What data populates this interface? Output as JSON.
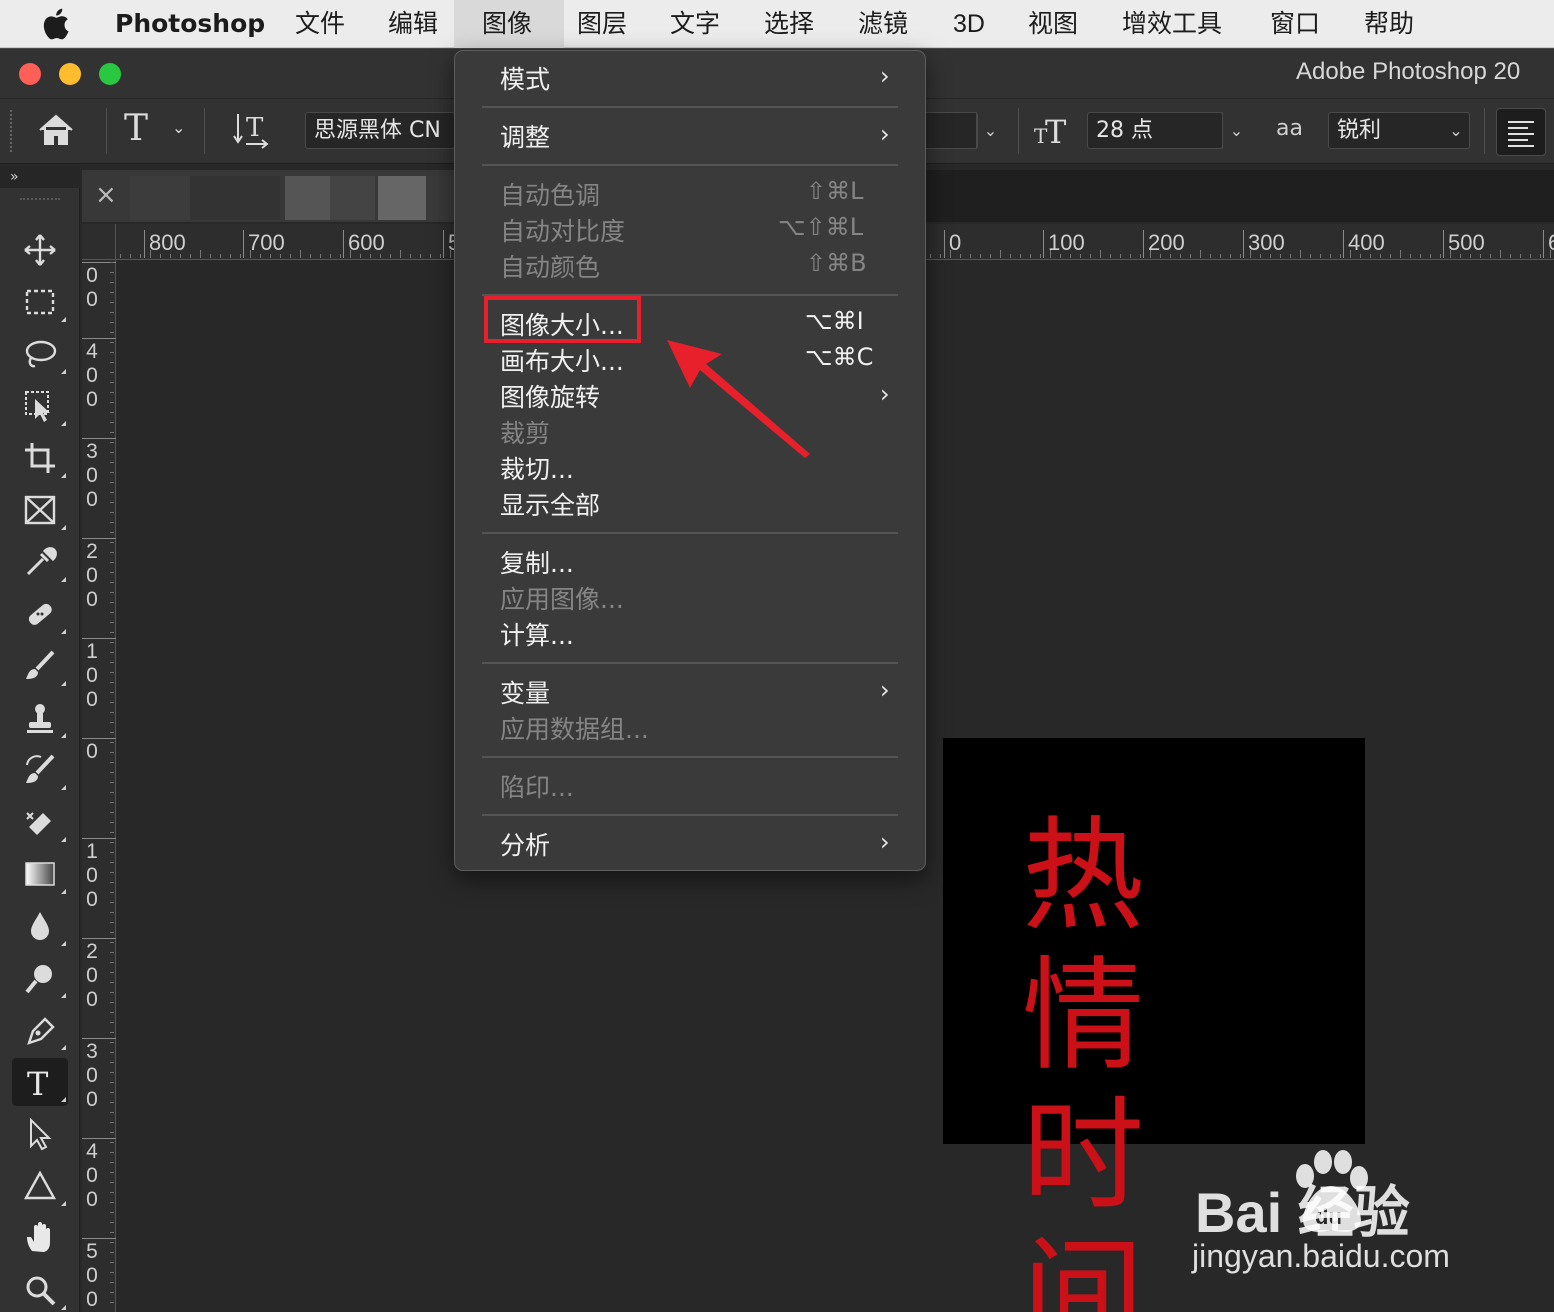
{
  "menubar": {
    "app_name": "Photoshop",
    "items": [
      "文件",
      "编辑",
      "图像",
      "图层",
      "文字",
      "选择",
      "滤镜",
      "3D",
      "视图",
      "增效工具",
      "窗口",
      "帮助"
    ],
    "active": "图像"
  },
  "window": {
    "title": "Adobe Photoshop 20"
  },
  "options_bar": {
    "font_family": "思源黑体 CN",
    "font_size": "28 点",
    "anti_alias_icon_label": "aa",
    "anti_alias": "锐利"
  },
  "rulers": {
    "horizontal_labels": [
      "800",
      "700",
      "600",
      "5",
      "0",
      "100",
      "200",
      "300",
      "400",
      "500",
      "6"
    ],
    "vertical_labels": [
      [
        "0",
        "0"
      ],
      [
        "4",
        "0",
        "0"
      ],
      [
        "3",
        "0",
        "0"
      ],
      [
        "2",
        "0",
        "0"
      ],
      [
        "1",
        "0",
        "0"
      ],
      [
        "0"
      ],
      [
        "1",
        "0",
        "0"
      ],
      [
        "2",
        "0",
        "0"
      ],
      [
        "3",
        "0",
        "0"
      ],
      [
        "4",
        "0",
        "0"
      ],
      [
        "5",
        "0",
        "0"
      ]
    ]
  },
  "image_menu": {
    "items": [
      {
        "label": "模式",
        "submenu": true,
        "enabled": true
      },
      {
        "label": "调整",
        "submenu": true,
        "enabled": true
      },
      {
        "label": "自动色调",
        "shortcut": "⇧⌘L",
        "enabled": false
      },
      {
        "label": "自动对比度",
        "shortcut": "⌥⇧⌘L",
        "enabled": false
      },
      {
        "label": "自动颜色",
        "shortcut": "⇧⌘B",
        "enabled": false
      },
      {
        "label": "图像大小...",
        "shortcut": "⌥⌘I",
        "enabled": true,
        "highlighted": true
      },
      {
        "label": "画布大小...",
        "shortcut": "⌥⌘C",
        "enabled": true
      },
      {
        "label": "图像旋转",
        "submenu": true,
        "enabled": true
      },
      {
        "label": "裁剪",
        "enabled": false
      },
      {
        "label": "裁切...",
        "enabled": true
      },
      {
        "label": "显示全部",
        "enabled": true
      },
      {
        "label": "复制...",
        "enabled": true
      },
      {
        "label": "应用图像...",
        "enabled": false
      },
      {
        "label": "计算...",
        "enabled": true
      },
      {
        "label": "变量",
        "submenu": true,
        "enabled": true
      },
      {
        "label": "应用数据组...",
        "enabled": false
      },
      {
        "label": "陷印...",
        "enabled": false
      },
      {
        "label": "分析",
        "submenu": true,
        "enabled": true
      }
    ]
  },
  "document": {
    "text_line1": "热情",
    "text_line2": "时间",
    "text_color": "#cc1018",
    "background": "#000000"
  },
  "annotation": {
    "box_color": "#e8202b",
    "arrow_color": "#e8202b"
  },
  "watermark": {
    "brand": "Bai  经验",
    "url": "jingyan.baidu.com"
  },
  "tools": [
    "move-tool",
    "marquee-tool",
    "lasso-tool",
    "object-select-tool",
    "crop-tool",
    "frame-tool",
    "eyedropper-tool",
    "healing-tool",
    "brush-tool",
    "stamp-tool",
    "history-brush-tool",
    "eraser-tool",
    "gradient-tool",
    "blur-tool",
    "dodge-tool",
    "pen-tool",
    "type-tool",
    "path-select-tool",
    "shape-tool",
    "hand-tool",
    "zoom-tool"
  ]
}
